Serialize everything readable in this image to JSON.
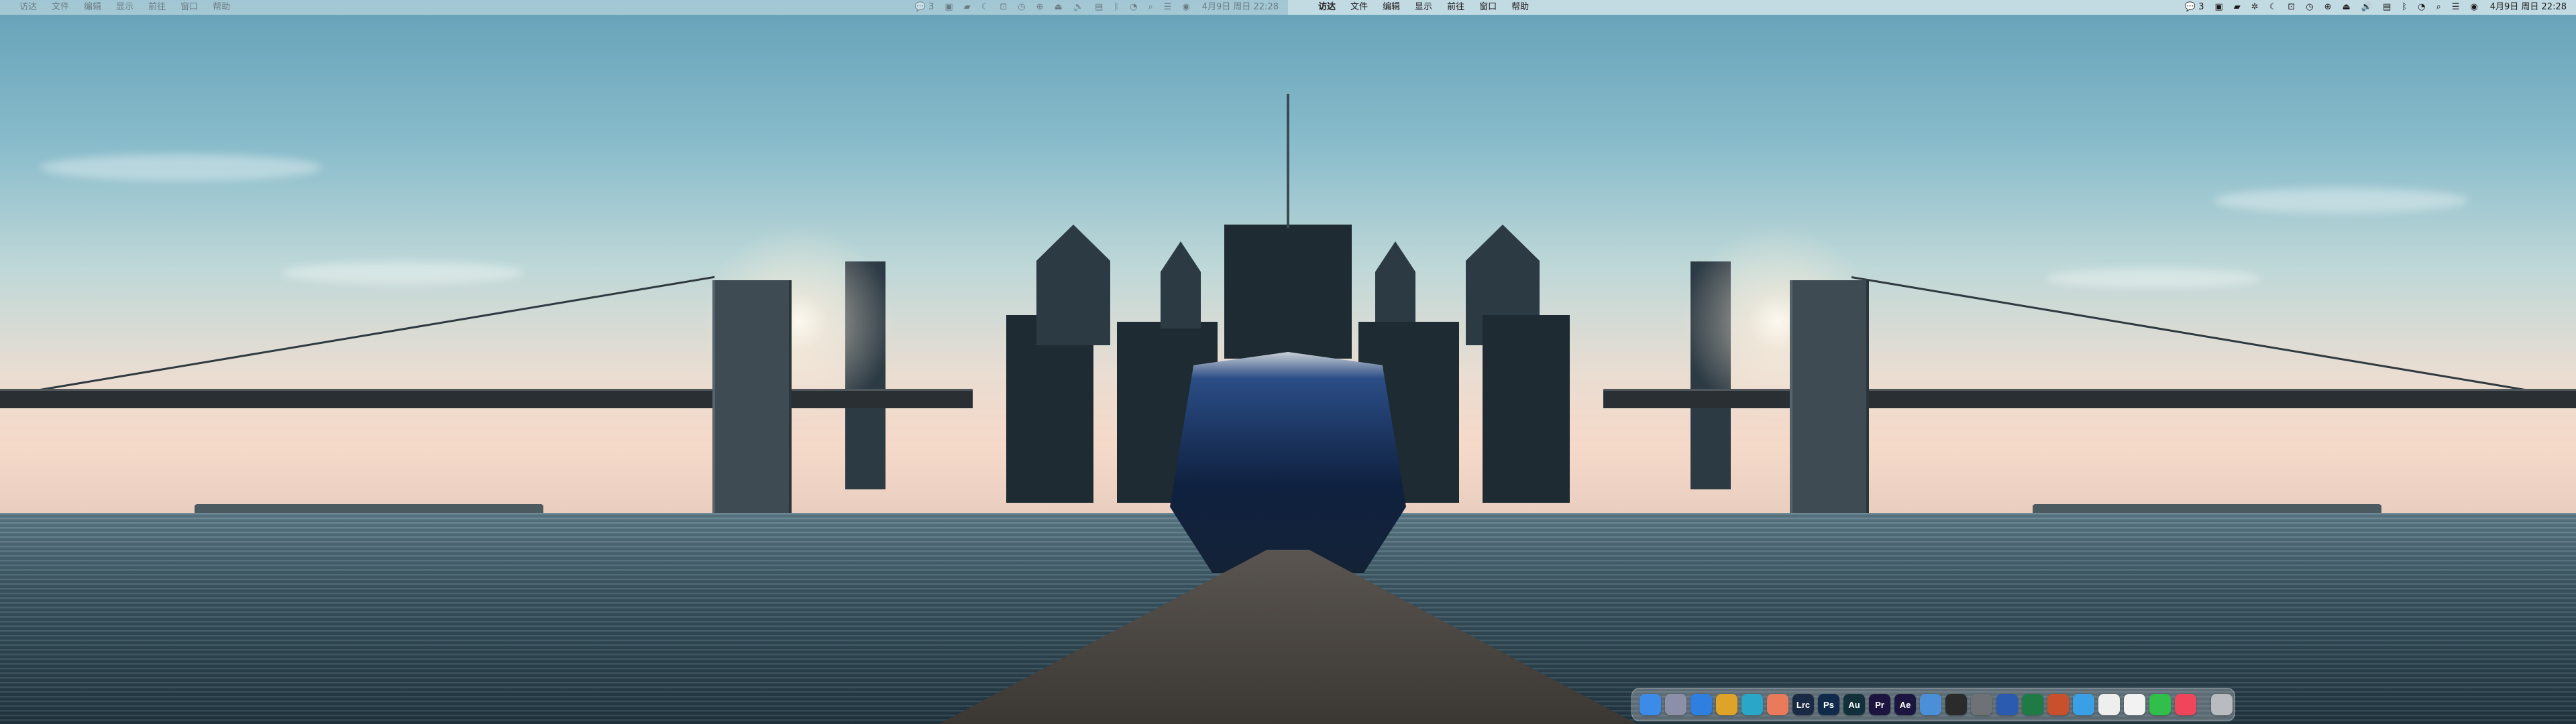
{
  "left_menubar": {
    "items": [
      "访达",
      "文件",
      "编辑",
      "显示",
      "前往",
      "窗口",
      "帮助"
    ],
    "status_icons": [
      {
        "name": "wechat-icon",
        "glyph": "💬",
        "badge": "3"
      },
      {
        "name": "terminal-icon",
        "glyph": "▣",
        "badge": ""
      },
      {
        "name": "chat-bubble-icon",
        "glyph": "▰",
        "badge": ""
      },
      {
        "name": "moon-icon",
        "glyph": "☾",
        "badge": ""
      },
      {
        "name": "screenshot-icon",
        "glyph": "⊡",
        "badge": ""
      },
      {
        "name": "timer-icon",
        "glyph": "◷",
        "badge": ""
      },
      {
        "name": "time-machine-icon",
        "glyph": "⊕",
        "badge": ""
      },
      {
        "name": "eject-icon",
        "glyph": "⏏",
        "badge": ""
      },
      {
        "name": "volume-icon",
        "glyph": "🔊",
        "badge": ""
      },
      {
        "name": "input-source-icon",
        "glyph": "▤",
        "badge": ""
      },
      {
        "name": "bluetooth-icon",
        "glyph": "ᛒ",
        "badge": ""
      },
      {
        "name": "wifi-icon",
        "glyph": "◔",
        "badge": ""
      },
      {
        "name": "search-icon",
        "glyph": "⌕",
        "badge": ""
      },
      {
        "name": "control-center-icon",
        "glyph": "☰",
        "badge": ""
      },
      {
        "name": "siri-icon",
        "glyph": "◉",
        "badge": ""
      }
    ],
    "clock": "4月9日 周日 22:28"
  },
  "right_menubar": {
    "apple_glyph": "",
    "items": [
      "访达",
      "文件",
      "编辑",
      "显示",
      "前往",
      "窗口",
      "帮助"
    ],
    "status_icons": [
      {
        "name": "wechat-icon",
        "glyph": "💬",
        "badge": "3"
      },
      {
        "name": "terminal-icon",
        "glyph": "▣",
        "badge": ""
      },
      {
        "name": "chat-bubble-icon",
        "glyph": "▰",
        "badge": ""
      },
      {
        "name": "gear-icon",
        "glyph": "✲",
        "badge": ""
      },
      {
        "name": "moon-icon",
        "glyph": "☾",
        "badge": ""
      },
      {
        "name": "screenshot-icon",
        "glyph": "⊡",
        "badge": ""
      },
      {
        "name": "timer-icon",
        "glyph": "◷",
        "badge": ""
      },
      {
        "name": "time-machine-icon",
        "glyph": "⊕",
        "badge": ""
      },
      {
        "name": "eject-icon",
        "glyph": "⏏",
        "badge": ""
      },
      {
        "name": "volume-icon",
        "glyph": "🔊",
        "badge": ""
      },
      {
        "name": "input-source-icon",
        "glyph": "▤",
        "badge": ""
      },
      {
        "name": "bluetooth-icon",
        "glyph": "ᛒ",
        "badge": ""
      },
      {
        "name": "wifi-icon",
        "glyph": "◔",
        "badge": ""
      },
      {
        "name": "search-icon",
        "glyph": "⌕",
        "badge": ""
      },
      {
        "name": "control-center-icon",
        "glyph": "☰",
        "badge": ""
      },
      {
        "name": "siri-icon",
        "glyph": "◉",
        "badge": ""
      }
    ],
    "clock": "4月9日 周日 22:28"
  },
  "dock": {
    "apps": [
      {
        "name": "finder-icon",
        "label": "",
        "color": "#3d8be8"
      },
      {
        "name": "launchpad-icon",
        "label": "",
        "color": "#8c8fa8"
      },
      {
        "name": "safari-icon",
        "label": "",
        "color": "#2f7fe0"
      },
      {
        "name": "chrome-icon",
        "label": "",
        "color": "#e0a32a"
      },
      {
        "name": "edge-icon",
        "label": "",
        "color": "#2aa6c8"
      },
      {
        "name": "photos-icon",
        "label": "",
        "color": "#e97b5a"
      },
      {
        "name": "lightroom-classic-icon",
        "label": "Lrc",
        "color": "#1b2a44"
      },
      {
        "name": "photoshop-icon",
        "label": "Ps",
        "color": "#0f2a4a"
      },
      {
        "name": "audition-icon",
        "label": "Au",
        "color": "#12303a"
      },
      {
        "name": "premiere-icon",
        "label": "Pr",
        "color": "#1d1540"
      },
      {
        "name": "after-effects-icon",
        "label": "Ae",
        "color": "#1b1640"
      },
      {
        "name": "finder-alt-icon",
        "label": "",
        "color": "#4a8fd8"
      },
      {
        "name": "final-cut-icon",
        "label": "",
        "color": "#2b2b2b"
      },
      {
        "name": "system-preferences-icon",
        "label": "",
        "color": "#6e7276"
      },
      {
        "name": "word-icon",
        "label": "",
        "color": "#2a5bb0"
      },
      {
        "name": "excel-icon",
        "label": "",
        "color": "#1f7a45"
      },
      {
        "name": "powerpoint-icon",
        "label": "",
        "color": "#c8502c"
      },
      {
        "name": "twitter-icon",
        "label": "",
        "color": "#3aa0e6"
      },
      {
        "name": "notes-icon",
        "label": "",
        "color": "#eeeeee"
      },
      {
        "name": "qq-icon",
        "label": "",
        "color": "#f2f2f2"
      },
      {
        "name": "wechat-dock-icon",
        "label": "",
        "color": "#2fbf4a"
      },
      {
        "name": "music-icon",
        "label": "",
        "color": "#f0455a"
      },
      {
        "name": "trash-icon",
        "label": "",
        "color": "#b8bcc0"
      }
    ]
  }
}
